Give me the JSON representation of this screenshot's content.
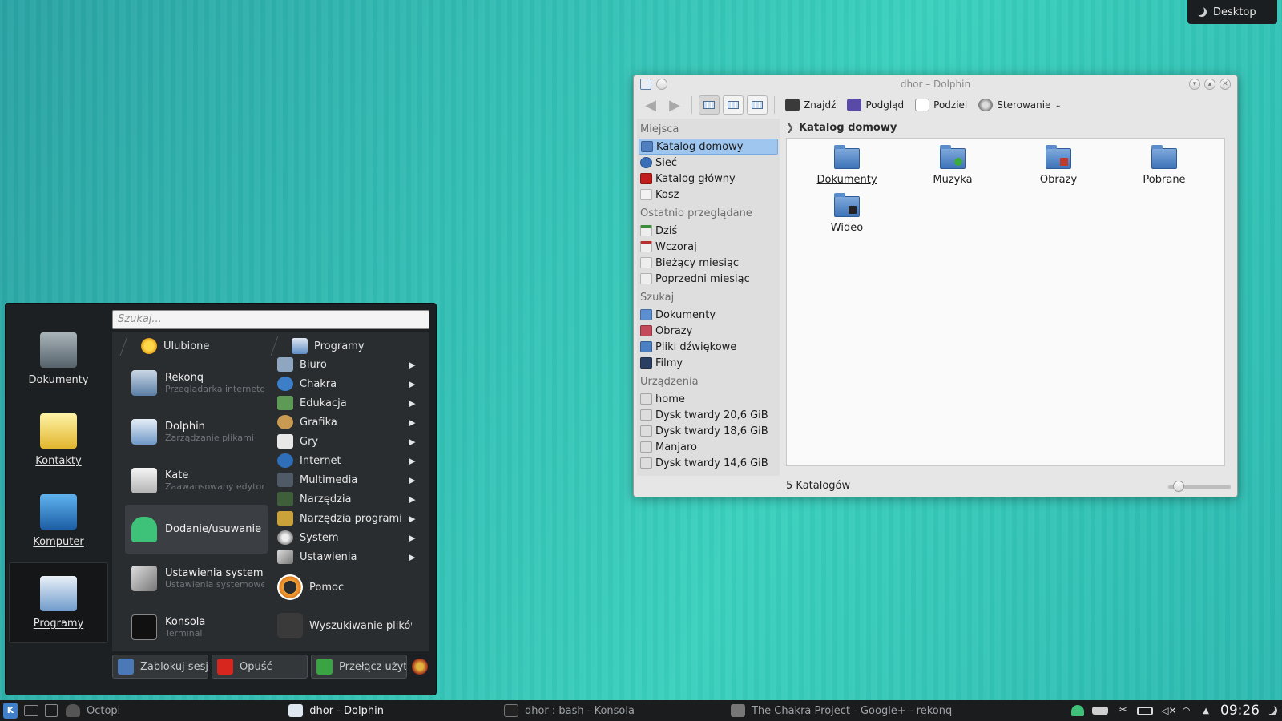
{
  "activity": {
    "label": "Desktop"
  },
  "dolphin": {
    "title": "dhor – Dolphin",
    "toolbar": {
      "find": "Znajdź",
      "preview": "Podgląd",
      "split": "Podziel",
      "control": "Sterowanie"
    },
    "places": {
      "sections": [
        {
          "title": "Miejsca",
          "items": [
            "Katalog domowy",
            "Sieć",
            "Katalog główny",
            "Kosz"
          ]
        },
        {
          "title": "Ostatnio przeglądane",
          "items": [
            "Dziś",
            "Wczoraj",
            "Bieżący miesiąc",
            "Poprzedni miesiąc"
          ]
        },
        {
          "title": "Szukaj",
          "items": [
            "Dokumenty",
            "Obrazy",
            "Pliki dźwiękowe",
            "Filmy"
          ]
        },
        {
          "title": "Urządzenia",
          "items": [
            "home",
            "Dysk twardy 20,6 GiB",
            "Dysk twardy 18,6 GiB",
            "Manjaro",
            "Dysk twardy 14,6 GiB"
          ]
        }
      ]
    },
    "breadcrumb": "Katalog domowy",
    "files": [
      "Dokumenty",
      "Muzyka",
      "Obrazy",
      "Pobrane",
      "Wideo"
    ],
    "status": "5 Katalogów"
  },
  "kickoff": {
    "search_placeholder": "Szukaj...",
    "side": [
      "Dokumenty",
      "Kontakty",
      "Komputer",
      "Programy"
    ],
    "favorites_header": "Ulubione",
    "programs_header": "Programy",
    "favorites": [
      {
        "name": "Rekonq",
        "desc": "Przeglądarka internetowa"
      },
      {
        "name": "Dolphin",
        "desc": "Zarządzanie plikami"
      },
      {
        "name": "Kate",
        "desc": "Zaawansowany edytor tekstu"
      },
      {
        "name": "Dodanie/usuwanie oprogramowania",
        "desc": ""
      },
      {
        "name": "Ustawienia systemowe",
        "desc": "Ustawienia systemowe"
      },
      {
        "name": "Konsola",
        "desc": "Terminal"
      }
    ],
    "categories": [
      "Biuro",
      "Chakra",
      "Edukacja",
      "Grafika",
      "Gry",
      "Internet",
      "Multimedia",
      "Narzędzia",
      "Narzędzia programistyczne",
      "System",
      "Ustawienia"
    ],
    "extra": [
      "Pomoc",
      "Wyszukiwanie plików"
    ],
    "buttons": {
      "lock": "Zablokuj sesję",
      "leave": "Opuść",
      "switch": "Przełącz użytkownika"
    }
  },
  "taskbar": {
    "tasks": [
      "Octopi",
      "dhor - Dolphin",
      "dhor : bash - Konsola",
      "The Chakra Project - Google+ - rekonq"
    ],
    "clock": "09:26"
  }
}
